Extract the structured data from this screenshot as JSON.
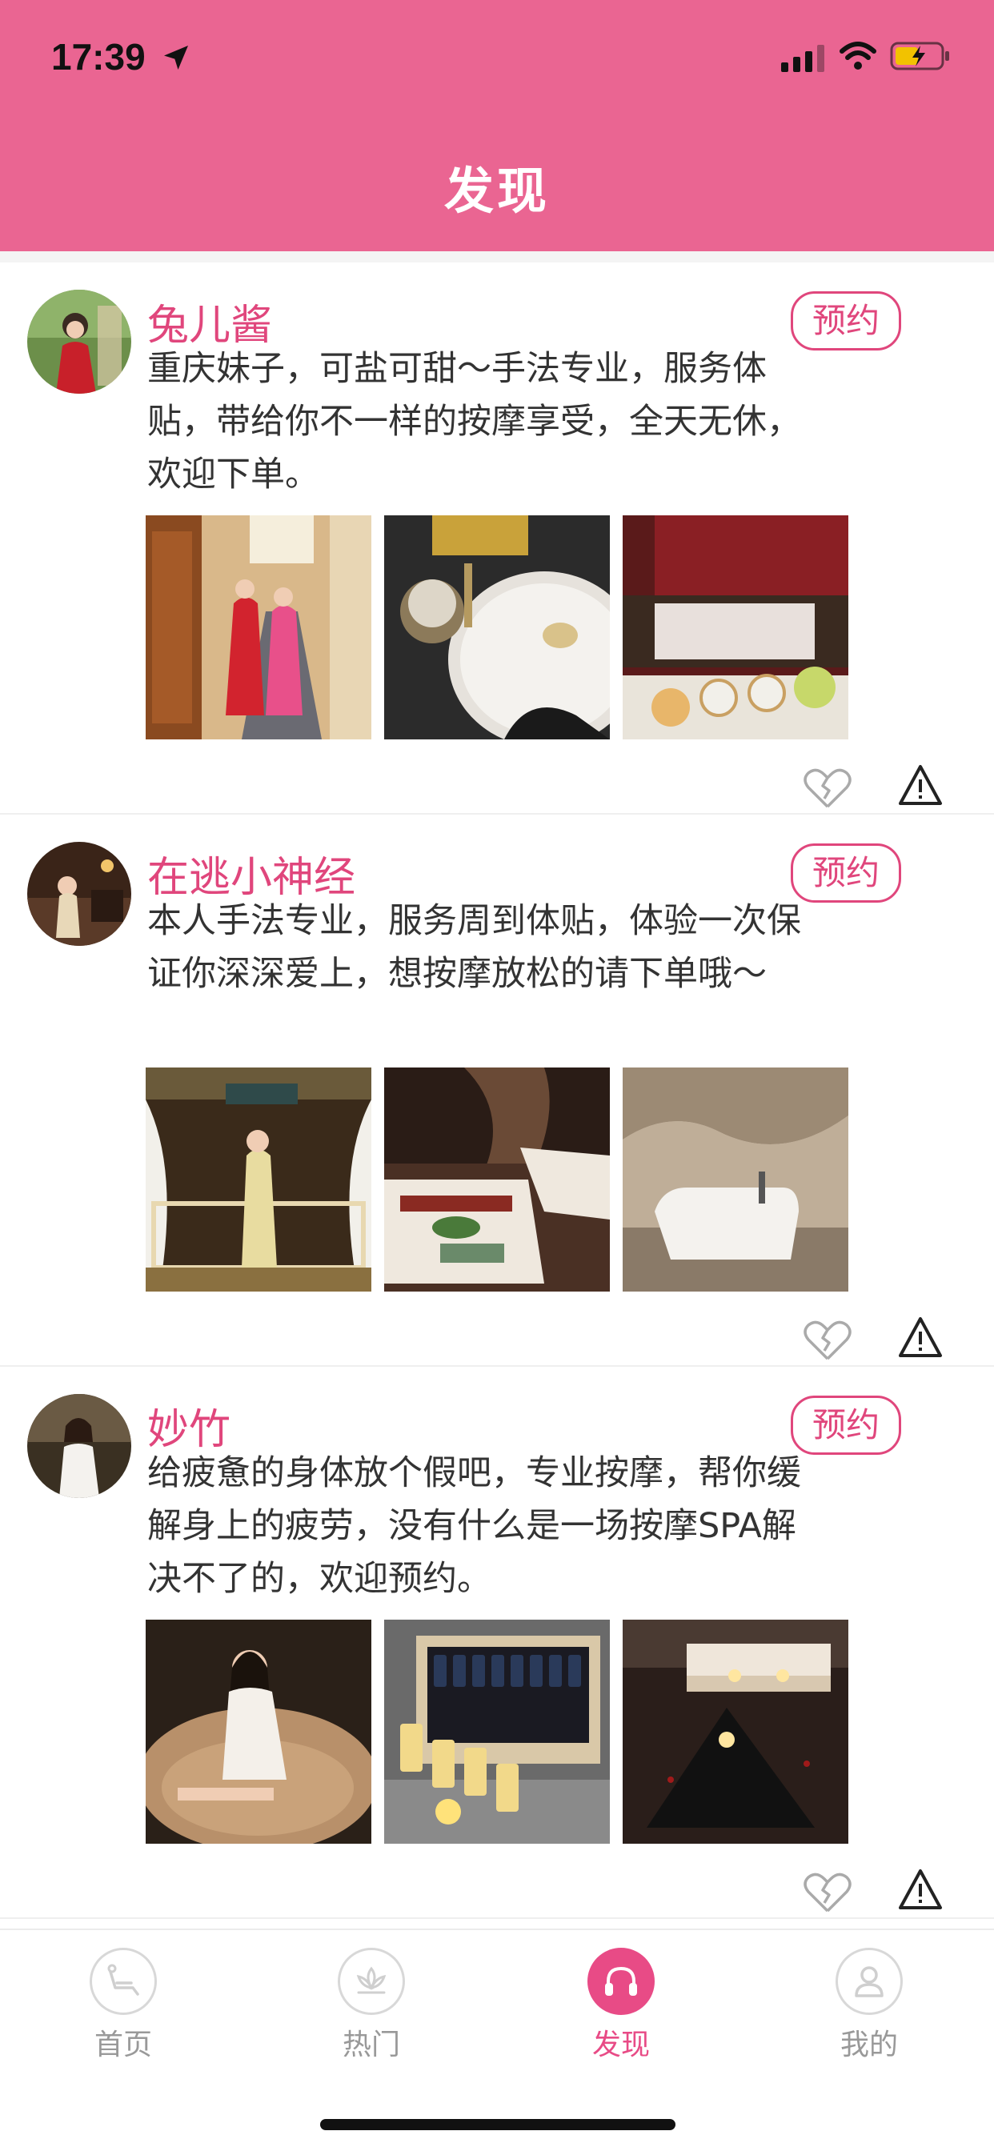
{
  "status_bar": {
    "time": "17:39"
  },
  "header": {
    "title": "发现"
  },
  "posts": [
    {
      "username": "兔儿酱",
      "book_label": "预约",
      "description": "重庆妹子，可盐可甜～手法专业，服务体贴，带给你不一样的按摩享受，全天无休，欢迎下单。"
    },
    {
      "username": "在逃小神经",
      "book_label": "预约",
      "description": "本人手法专业，服务周到体贴，体验一次保证你深深爱上，想按摩放松的请下单哦～"
    },
    {
      "username": "妙竹",
      "book_label": "预约",
      "description": "给疲惫的身体放个假吧，专业按摩，帮你缓解身上的疲劳，没有什么是一场按摩SPA解决不了的，欢迎预约。"
    }
  ],
  "tabs": [
    {
      "label": "首页",
      "icon": "massage-chair-icon",
      "active": false
    },
    {
      "label": "热门",
      "icon": "lotus-icon",
      "active": false
    },
    {
      "label": "发现",
      "icon": "headphones-icon",
      "active": true
    },
    {
      "label": "我的",
      "icon": "user-icon",
      "active": false
    }
  ],
  "colors": {
    "brand": "#ea6592",
    "accent": "#e0467c"
  }
}
